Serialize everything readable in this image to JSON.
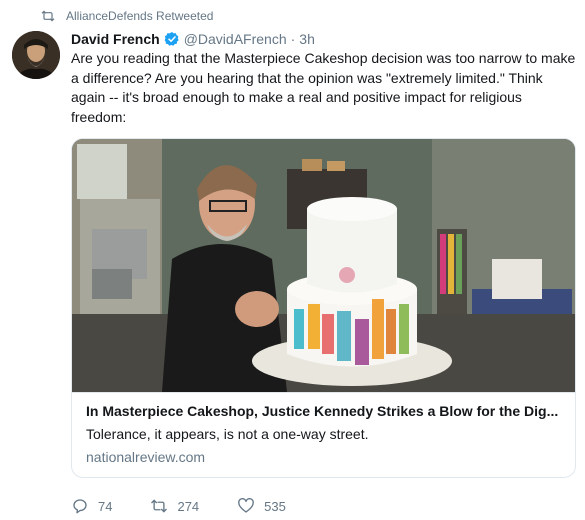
{
  "retweet_context": {
    "label": "AllianceDefends Retweeted",
    "icon": "retweet-icon"
  },
  "tweet": {
    "display_name": "David French",
    "verified": true,
    "handle": "@DavidAFrench",
    "separator": "·",
    "time": "3h",
    "text": "Are you reading that the Masterpiece Cakeshop decision was too narrow to make a difference? Are you hearing that the opinion was \"extremely limited.\" Think again -- it's broad enough to make a real and positive impact for religious freedom:"
  },
  "card": {
    "title": "In Masterpiece Cakeshop, Justice Kennedy Strikes a Blow for the Dig...",
    "description": "Tolerance, it appears, is not a one-way street.",
    "domain": "nationalreview.com"
  },
  "actions": {
    "reply_count": "74",
    "retweet_count": "274",
    "like_count": "535"
  },
  "colors": {
    "verified": "#1da1f2",
    "secondary_text": "#657786",
    "border": "#e1e8ed"
  }
}
